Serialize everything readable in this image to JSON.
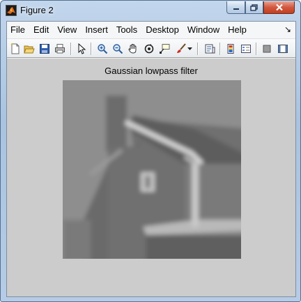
{
  "window": {
    "title": "Figure 2",
    "icon": "matlab-icon",
    "controls": [
      "minimize-icon",
      "maximize-icon",
      "close-icon"
    ]
  },
  "menubar": {
    "items": [
      "File",
      "Edit",
      "View",
      "Insert",
      "Tools",
      "Desktop",
      "Window",
      "Help"
    ],
    "overflow_icon": "dock-arrow-icon"
  },
  "toolbar": {
    "icons": [
      "new-figure-icon",
      "open-file-icon",
      "save-figure-icon",
      "print-figure-icon",
      "edit-plot-icon",
      "zoom-in-icon",
      "zoom-out-icon",
      "pan-icon",
      "rotate-3d-icon",
      "data-cursor-icon",
      "brush-icon",
      "brush-dropdown-icon",
      "link-plot-icon",
      "insert-colorbar-icon",
      "insert-legend-icon",
      "hide-plot-tools-icon",
      "show-plot-tools-icon"
    ]
  },
  "figure": {
    "title": "Gaussian lowpass filter",
    "image_description_colors": {
      "sky": "#8f8f8f",
      "wall": "#6a6a6a",
      "roof": "#5c5c5c"
    },
    "background": "#cccccc"
  }
}
